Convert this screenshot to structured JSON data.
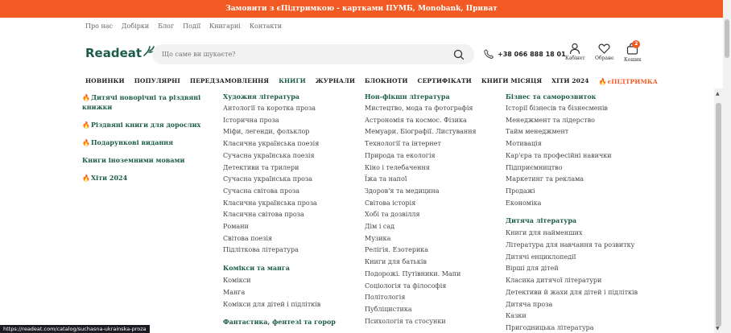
{
  "promo": "Замовити з єПідтримкою - картками ПУМБ, Monobank, Приват",
  "topnav": [
    "Про нас",
    "Добірки",
    "Блог",
    "Події",
    "Книгарні",
    "Контакти"
  ],
  "logo": "Readeat",
  "search": {
    "placeholder": "Що саме ви шукаєте?"
  },
  "phone": "+38 066 888 18 01",
  "header_icons": {
    "cabinet": "Кабінет",
    "favorites": "Обране",
    "cart": "Кошик",
    "cart_count": "2"
  },
  "mainnav": [
    "НОВИНКИ",
    "ПОПУЛЯРНІ",
    "ПЕРЕДЗАМОВЛЕННЯ",
    "КНИГИ",
    "ЖУРНАЛИ",
    "БЛОКНОТИ",
    "СЕРТИФІКАТИ",
    "КНИГИ МІСЯЦЯ",
    "ХІТИ 2024",
    "єПІДТРИМКА"
  ],
  "col1": [
    "Дитячі новорічні та різдвяні книжки",
    "Різдвяні книги для дорослих",
    "Подарункові видання",
    "Книги іноземними мовами",
    "Хіти 2024"
  ],
  "col2": {
    "head1": "Художня література",
    "links1": [
      "Антології та коротка проза",
      "Історична проза",
      "Міфи, легенди, фольклор",
      "Класична українська поезія",
      "Сучасна українська поезія",
      "Детективи та трилери",
      "Сучасна українська проза",
      "Сучасна світова проза",
      "Класична українська проза",
      "Класична світова проза",
      "Романи",
      "Світова поезія",
      "Підліткова література"
    ],
    "head2": "Комікси та манга",
    "links2": [
      "Комікси",
      "Манга",
      "Комікси для дітей і підлітків"
    ],
    "head3": "Фантастика, фентезі та горор"
  },
  "col3": {
    "head1": "Нон-фікшн література",
    "links1": [
      "Мистецтво, мода та фотографія",
      "Астрономія та космос. Фізика",
      "Мемуари. Біографії. Листування",
      "Технології та інтернет",
      "Природа та екологія",
      "Кіно і телебачення",
      "Їжа та напої",
      "Здоров'я та медицина",
      "Світова історія",
      "Хобі та дозвілля",
      "Дім і сад",
      "Музика",
      "Релігія. Езотерика",
      "Книги для батьків",
      "Подорожі. Путівники. Мапи",
      "Соціологія та філософія",
      "Політологія",
      "Публіцистика",
      "Психологія та стосунки"
    ]
  },
  "col4": {
    "head1": "Бізнес та саморозвиток",
    "links1": [
      "Історії бізнесів та бізнесменів",
      "Менеджмент та лідерство",
      "Тайм менеджмент",
      "Мотивація",
      "Кар'єра та професійні навички",
      "Підприємництво",
      "Маркетинг та реклама",
      "Продажі",
      "Економіка"
    ],
    "head2": "Дитяча література",
    "links2": [
      "Книги для найменших",
      "Література для навчання та розвитку",
      "Дитячі енциклопедії",
      "Вірші для дітей",
      "Класика дитячої літератури",
      "Детективи й жахи для дітей і підлітків",
      "Дитяча проза",
      "Казки",
      "Пригодницька література"
    ]
  },
  "status_url": "https://readeat.com/catalog/suchasna-ukrainska-proza",
  "colors": {
    "accent": "#f15a22",
    "brand": "#1d5c4a"
  }
}
